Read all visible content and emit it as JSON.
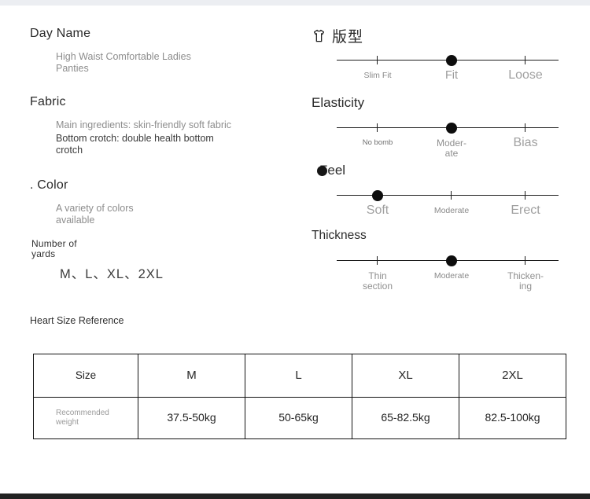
{
  "specs": [
    {
      "title": "Day Name",
      "title_size": "large",
      "value": "High Waist Comfortable Ladies Panties",
      "value_tone": "muted"
    },
    {
      "title": "Fabric",
      "title_size": "large",
      "value": "Main ingredients: skin-friendly soft fabric",
      "value2": "Bottom crotch: double health bottom crotch",
      "value_tone": "muted"
    },
    {
      "title": ". Color",
      "title_size": "large",
      "value": "A variety of colors available",
      "value_tone": "muted"
    },
    {
      "title": "Number of yards",
      "title_size": "small",
      "value": "M、L、XL、2XL",
      "value_tone": "big"
    }
  ],
  "reference_title": "Heart Size Reference",
  "sliders": [
    {
      "label": "版型",
      "icon": "tshirt-icon",
      "lang": "cjk",
      "knob_index": 1,
      "scale": [
        {
          "text": "Slim Fit",
          "size": "sz-s"
        },
        {
          "text": "Fit",
          "size": "sz-l"
        },
        {
          "text": "Loose",
          "size": "sz-xl"
        }
      ]
    },
    {
      "label": "Elasticity",
      "icon": "none",
      "lang": "latin",
      "knob_index": 1,
      "scale": [
        {
          "text": "No bomb",
          "size": "sz-xs"
        },
        {
          "text": "Moder-\nate",
          "size": "sz-m"
        },
        {
          "text": "Bias",
          "size": "sz-xl"
        }
      ]
    },
    {
      "label": "Feel",
      "icon": "circle-icon",
      "lang": "latin",
      "knob_index": 0,
      "scale": [
        {
          "text": "Soft",
          "size": "sz-xl"
        },
        {
          "text": "Moderate",
          "size": "sz-s"
        },
        {
          "text": "Erect",
          "size": "sz-xl"
        }
      ]
    },
    {
      "label": "Thickness",
      "icon": "none",
      "lang": "latin",
      "knob_index": 1,
      "scale": [
        {
          "text": "Thin\nsection",
          "size": "sz-m"
        },
        {
          "text": "Moderate",
          "size": "sz-s"
        },
        {
          "text": "Thicken-\ning",
          "size": "sz-m"
        }
      ]
    }
  ],
  "size_table": {
    "header": [
      "Size",
      "M",
      "L",
      "XL",
      "2XL"
    ],
    "row_label": "Recommended weight",
    "values": [
      "37.5-50kg",
      "50-65kg",
      "65-82.5kg",
      "82.5-100kg"
    ]
  },
  "colors": {
    "ink": "#222222",
    "muted": "#8d8d8d",
    "line": "#1d1d1d",
    "top_band": "#eceef2",
    "bottom_band": "#222222"
  }
}
